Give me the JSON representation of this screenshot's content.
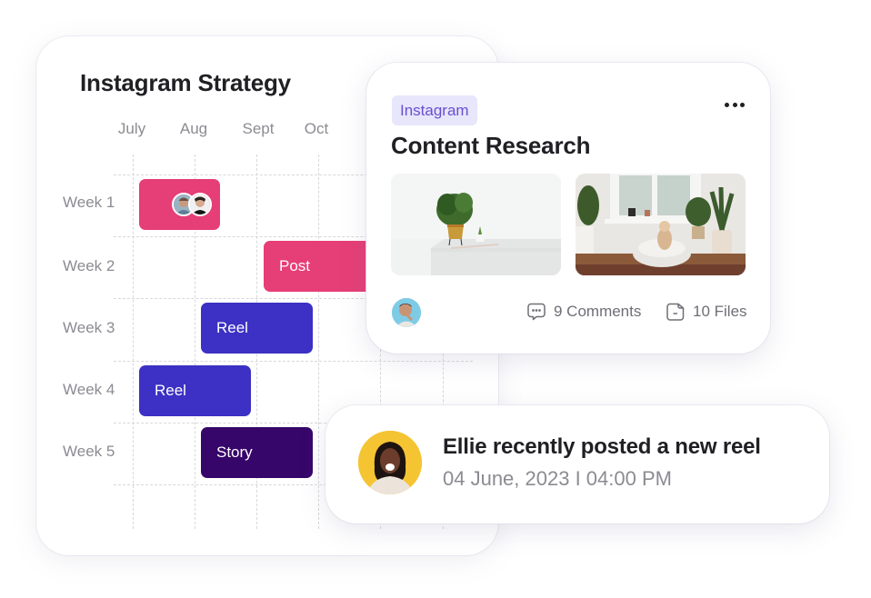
{
  "strategy": {
    "title": "Instagram Strategy",
    "months": [
      "July",
      "Aug",
      "Sept",
      "Oct"
    ],
    "weeks": [
      "Week 1",
      "Week 2",
      "Week 3",
      "Week 4",
      "Week 5"
    ],
    "tasks": [
      {
        "week": "Week 1",
        "label": "",
        "color": "#e63e76",
        "has_avatars": true,
        "avatars": [
          "team-member-1",
          "team-member-2"
        ]
      },
      {
        "week": "Week 2",
        "label": "Post",
        "color": "#e63e76"
      },
      {
        "week": "Week 3",
        "label": "Reel",
        "color": "#3c31c4"
      },
      {
        "week": "Week 4",
        "label": "Reel",
        "color": "#3c31c4"
      },
      {
        "week": "Week 5",
        "label": "Story",
        "color": "#37066a"
      }
    ]
  },
  "research": {
    "tag": "Instagram",
    "title": "Content Research",
    "more_icon": "more-horizontal-icon",
    "images": [
      {
        "alt": "Potted plant on white table"
      },
      {
        "alt": "Dog resting on bed in plant-filled room"
      }
    ],
    "comments": "9 Comments",
    "files": "10 Files",
    "comment_icon": "comment-icon",
    "file_icon": "folder-icon"
  },
  "notification": {
    "title": "Ellie recently posted a new reel",
    "timestamp": "04 June, 2023 I 04:00 PM"
  },
  "colors": {
    "post_pink": "#e63e76",
    "reel_blue": "#3c31c4",
    "story_purple": "#37066a",
    "tag_bg": "#e7e6fb",
    "tag_text": "#6a4fd0"
  }
}
